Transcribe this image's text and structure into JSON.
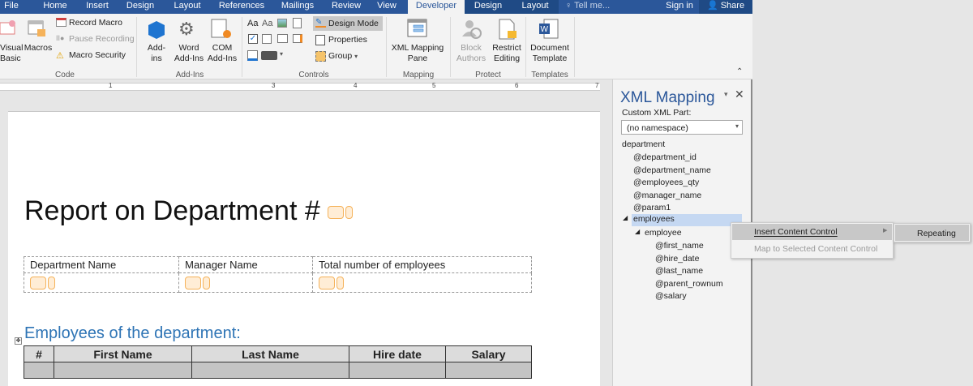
{
  "tabs": [
    "File",
    "Home",
    "Insert",
    "Design",
    "Layout",
    "References",
    "Mailings",
    "Review",
    "View",
    "Developer",
    "Design",
    "Layout"
  ],
  "tell_me": "Tell me...",
  "sign_in": "Sign in",
  "share": "Share",
  "ribbon": {
    "code": {
      "visual_basic": "Visual Basic",
      "macros": "Macros",
      "record_macro": "Record Macro",
      "pause_recording": "Pause Recording",
      "macro_security": "Macro Security",
      "label": "Code"
    },
    "addins": {
      "addins": "Add-ins",
      "word_addins": "Word Add-Ins",
      "com_addins": "COM Add-Ins",
      "label": "Add-Ins"
    },
    "controls": {
      "design_mode": "Design Mode",
      "properties": "Properties",
      "group": "Group",
      "label": "Controls"
    },
    "mapping": {
      "xml_mapping_pane": "XML Mapping Pane",
      "label": "Mapping"
    },
    "protect": {
      "block_authors": "Block Authors",
      "restrict_editing": "Restrict Editing",
      "label": "Protect"
    },
    "templates": {
      "document_template": "Document Template",
      "label": "Templates"
    }
  },
  "ruler": [
    "1",
    "3",
    "4",
    "5",
    "6",
    "7"
  ],
  "document": {
    "title": "Report on Department #",
    "info_headers": [
      "Department Name",
      "Manager Name",
      "Total number of employees"
    ],
    "section_heading": "Employees of the department:",
    "emp_headers": [
      "#",
      "First Name",
      "Last Name",
      "Hire date",
      "Salary"
    ]
  },
  "pane": {
    "title": "XML Mapping",
    "custom_xml_part_label": "Custom XML Part:",
    "custom_xml_part_value": "(no namespace)",
    "tree": [
      "department",
      "@department_id",
      "@department_name",
      "@employees_qty",
      "@manager_name",
      "@param1",
      "employees",
      "employee",
      "@first_name",
      "@hire_date",
      "@last_name",
      "@parent_rownum",
      "@salary"
    ]
  },
  "context_menu": {
    "insert_content_control": "Insert Content Control",
    "map_to_selected": "Map to Selected Content Control"
  },
  "submenu": {
    "repeating": "Repeating"
  },
  "colors": {
    "accent": "#2b579a",
    "heading_blue": "#2e74b5",
    "cc_orange": "#f5b25a"
  }
}
